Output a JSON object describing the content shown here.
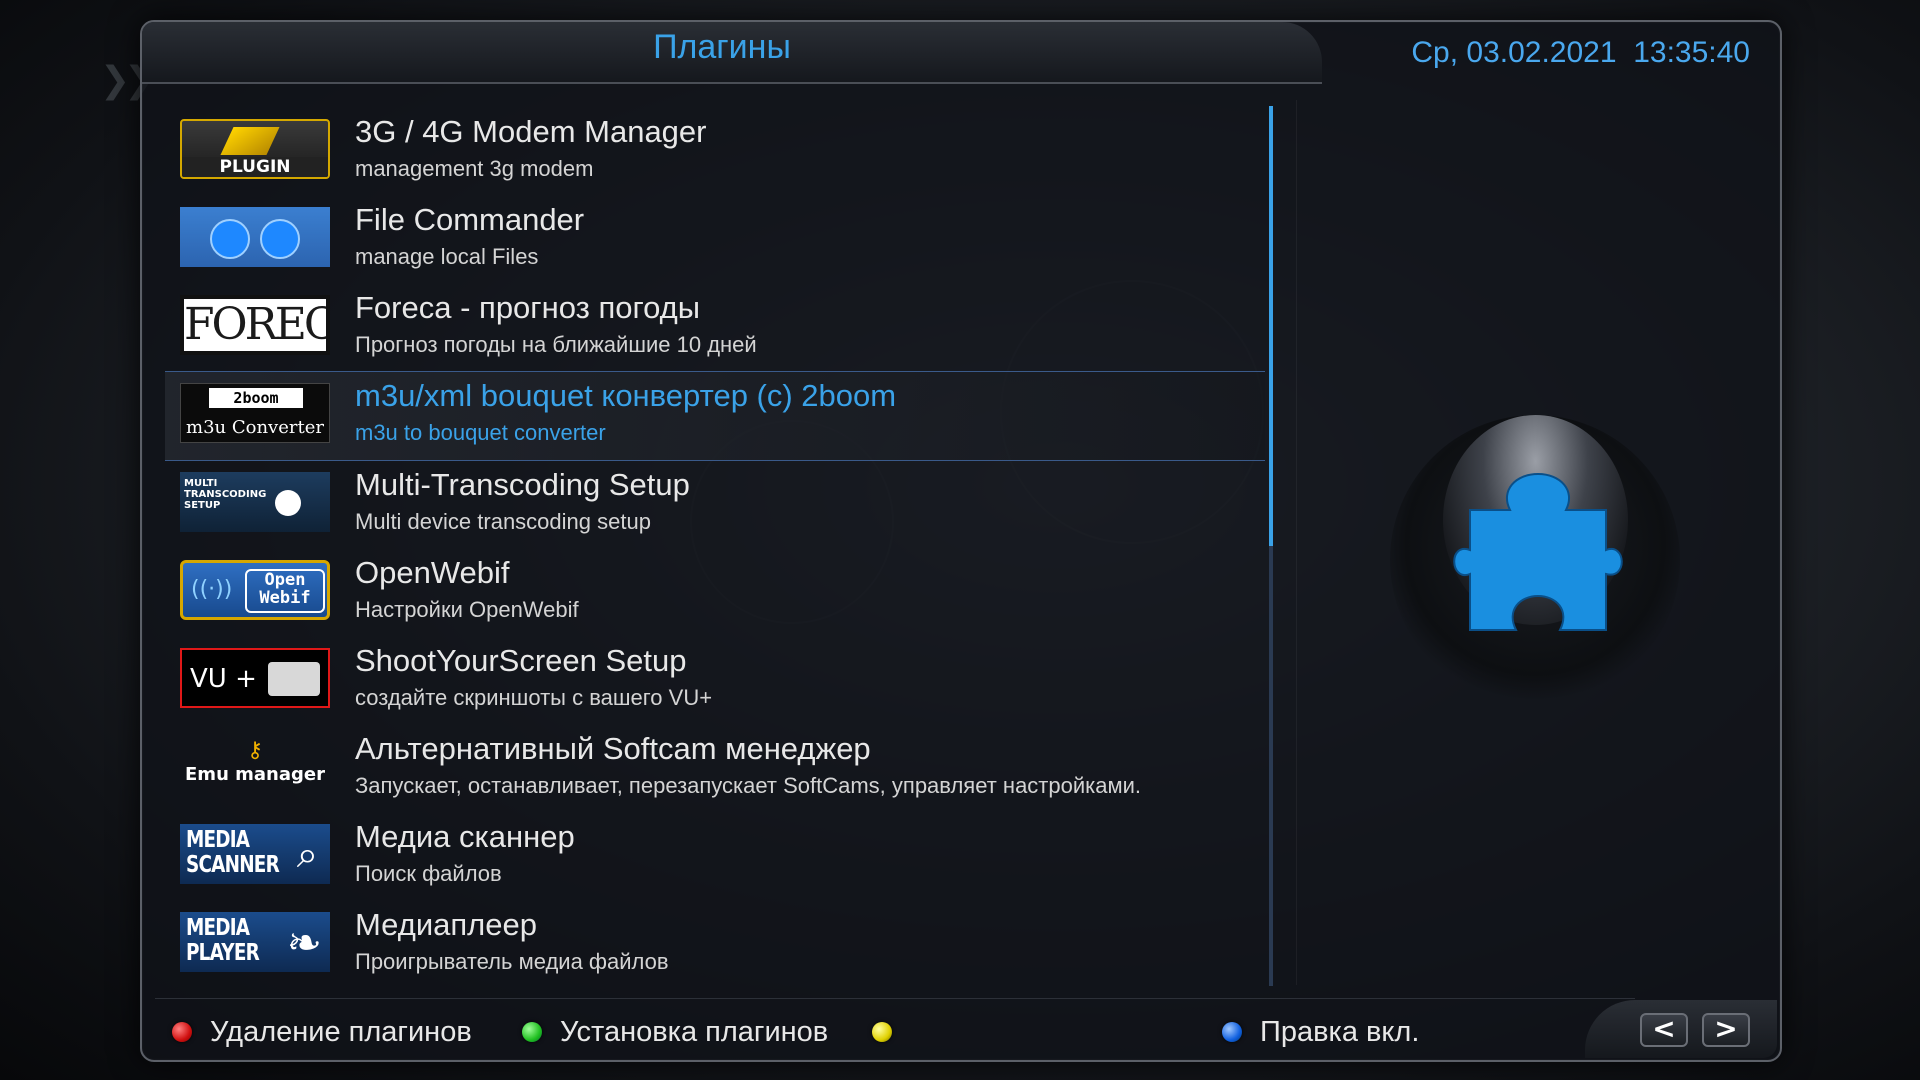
{
  "header": {
    "title": "Плагины",
    "clock": "Ср, 03.02.2021  13:35:40"
  },
  "plugins": [
    {
      "title": "3G / 4G Modem Manager",
      "description": "management 3g modem",
      "icon": "plugin-icon",
      "thumb_text": "PLUGIN"
    },
    {
      "title": "File Commander",
      "description": "manage local Files",
      "icon": "folder-icon"
    },
    {
      "title": "Foreca - прогноз погоды",
      "description": "Прогноз погоды на ближайшие 10 дней",
      "icon": "foreca-logo",
      "thumb_text": "FORECA"
    },
    {
      "title": "m3u/xml bouquet конвертер (c) 2boom",
      "description": "m3u to bouquet converter",
      "icon": "m3u-converter-logo",
      "thumb_text_top": "2boom",
      "thumb_text": "m3u Converter",
      "selected": true
    },
    {
      "title": "Multi-Transcoding Setup",
      "description": "Multi device transcoding setup",
      "icon": "transcoding-icon",
      "thumb_text": "MULTI TRANSCODING SETUP"
    },
    {
      "title": "OpenWebif",
      "description": "Настройки OpenWebif",
      "icon": "openwebif-logo",
      "thumb_text": "Open Webif"
    },
    {
      "title": "ShootYourScreen Setup",
      "description": "создайте скриншоты с вашего VU+",
      "icon": "camera-icon",
      "thumb_text": "VU +"
    },
    {
      "title": "Альтернативный Softcam менеджер",
      "description": "Запускает, останавливает, перезапускает SoftCams, управляет настройками.",
      "icon": "key-icon",
      "thumb_text": "Emu manager"
    },
    {
      "title": "Медиа сканнер",
      "description": "Поиск файлов",
      "icon": "magnifier-icon",
      "thumb_text": "MEDIA SCANNER"
    },
    {
      "title": "Медиаплеер",
      "description": "Проигрыватель медиа файлов",
      "icon": "film-icon",
      "thumb_text": "MEDIA PLAYER"
    }
  ],
  "scrollbar": {
    "position_fraction": 0.0,
    "visible_fraction": 0.5
  },
  "footer": {
    "red_label": "Удаление плагинов",
    "green_label": "Установка плагинов",
    "yellow_label": "",
    "blue_label": "Правка вкл.",
    "prev_label": "<",
    "next_label": ">"
  },
  "colors": {
    "accent": "#3aa2e8",
    "red": "#d01010",
    "green": "#20c020",
    "yellow": "#e0d000",
    "blue": "#1060e0",
    "puzzle": "#1a8fe0"
  }
}
